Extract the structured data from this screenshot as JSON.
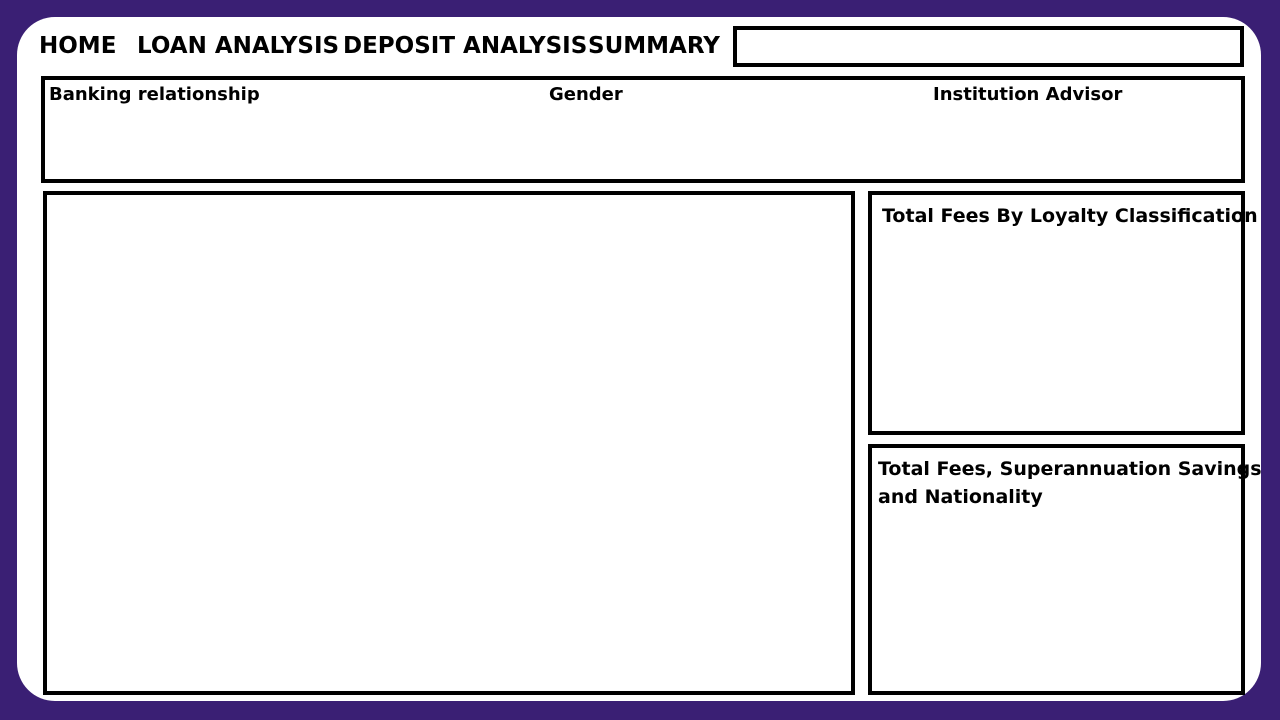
{
  "nav": {
    "home": "HOME",
    "loan_analysis": "LOAN ANALYSIS",
    "deposit_analysis": "DEPOSIT ANALYSIS",
    "summary": "SUMMARY"
  },
  "filters": {
    "banking_relationship": "Banking relationship",
    "gender": "Gender",
    "institution_advisor": "Institution Advisor"
  },
  "panels": {
    "loyalty_title": "Total Fees By Loyalty Classification",
    "superannuation_title_line1": "Total Fees, Superannuation Savings",
    "superannuation_title_line2": "and Nationality"
  },
  "colors": {
    "background": "#3a1f74",
    "canvas": "#ffffff",
    "border": "#000000"
  }
}
